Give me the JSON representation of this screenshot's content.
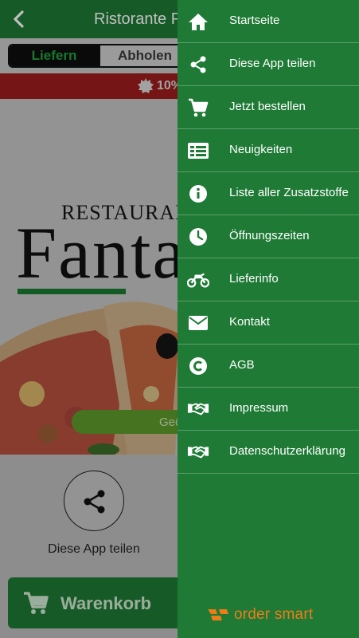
{
  "header": {
    "title": "Ristorante Pizzeria Fantasia"
  },
  "order_mode": {
    "options": [
      "Liefern",
      "Abholen"
    ],
    "selected": "Liefern"
  },
  "banner": {
    "text": "10%"
  },
  "hero": {
    "restaurant_text": "RESTAURANT",
    "brand_text": "Fantasia",
    "button_text": "Geöffnet"
  },
  "share": {
    "label": "Diese App teilen"
  },
  "cart": {
    "label": "Warenkorb"
  },
  "menu": {
    "items": [
      {
        "label": "Startseite",
        "icon": "home-icon"
      },
      {
        "label": "Diese App teilen",
        "icon": "share-icon"
      },
      {
        "label": "Jetzt bestellen",
        "icon": "cart-icon"
      },
      {
        "label": "Neuigkeiten",
        "icon": "news-icon"
      },
      {
        "label": "Liste aller Zusatzstoffe",
        "icon": "info-icon"
      },
      {
        "label": "Öffnungszeiten",
        "icon": "clock-icon"
      },
      {
        "label": "Lieferinfo",
        "icon": "motorbike-icon"
      },
      {
        "label": "Kontakt",
        "icon": "mail-icon"
      },
      {
        "label": "AGB",
        "icon": "copyright-icon"
      },
      {
        "label": "Impressum",
        "icon": "handshake-icon"
      },
      {
        "label": "Datenschutzerklärung",
        "icon": "handshake-icon"
      }
    ],
    "footer_logo": "order smart"
  },
  "colors": {
    "primary": "#1e7a35",
    "banner": "#9c1c1c",
    "accent": "#f07c18"
  }
}
